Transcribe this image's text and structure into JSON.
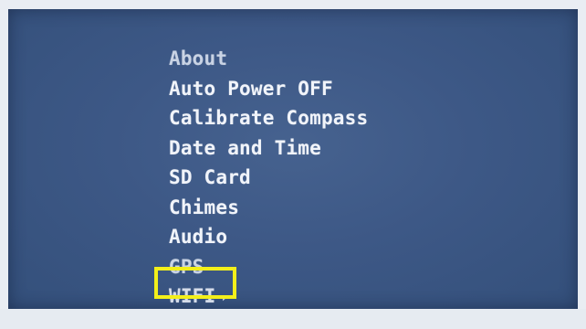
{
  "menu": {
    "items": [
      {
        "label": "About"
      },
      {
        "label": "Auto Power OFF"
      },
      {
        "label": "Calibrate Compass"
      },
      {
        "label": "Date and Time"
      },
      {
        "label": "SD Card"
      },
      {
        "label": "Chimes"
      },
      {
        "label": "Audio"
      },
      {
        "label": "GPS"
      },
      {
        "label": "WIFI",
        "submenu_indicator": "›"
      }
    ],
    "highlighted_index": 8
  },
  "colors": {
    "screen_background": "#3d5886",
    "menu_text": "#f1f4fa",
    "highlight_box": "#f3ef1a"
  }
}
